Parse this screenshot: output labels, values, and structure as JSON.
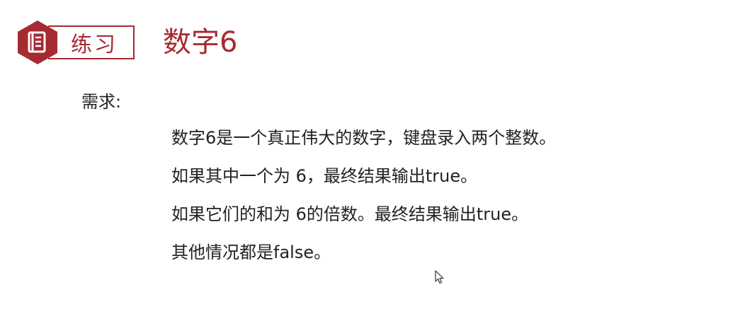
{
  "header": {
    "badge_icon": "document-icon",
    "label": "练习",
    "title": "数字6",
    "accent_color": "#a52a32"
  },
  "requirements": {
    "label": "需求:",
    "lines": [
      "数字6是一个真正伟大的数字，键盘录入两个整数。",
      "如果其中一个为 6，最终结果输出true。",
      "如果它们的和为 6的倍数。最终结果输出true。",
      "其他情况都是false。"
    ]
  }
}
